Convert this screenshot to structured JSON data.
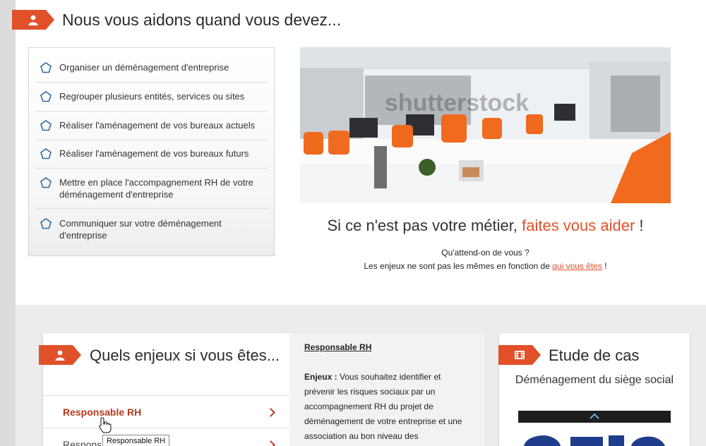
{
  "help_section": {
    "title": "Nous vous aidons quand vous devez...",
    "items": [
      {
        "text": "Organiser un déménagement d'entreprise"
      },
      {
        "text": "Regrouper plusieurs entités, services ou sites"
      },
      {
        "text": "Réaliser l'aménagement de vos bureaux actuels"
      },
      {
        "text": "Réaliser l'aménagement de vos bureaux futurs"
      },
      {
        "text": "Mettre en place l'accompagnement RH de votre déménagement d'entreprise"
      },
      {
        "text": "Communiquer sur votre déménagement d'entreprise"
      }
    ],
    "photo_watermark": "shutterstock",
    "tagline_main": "Si ce n'est pas votre métier, ",
    "tagline_accent": "faites vous aider",
    "tagline_end": " !",
    "question": "Qu'attend-on de vous ?",
    "enjeux_text": "Les enjeux ne sont pas les mêmes en fonction de ",
    "enjeux_link": "qui vous êtes",
    "enjeux_end": " !"
  },
  "enjeux_section": {
    "title": "Quels enjeux si vous êtes...",
    "items": [
      {
        "label": "Responsable RH",
        "active": true
      },
      {
        "label": "Respons",
        "active": false
      }
    ],
    "detail_title": "Responsable RH",
    "detail_label": "Enjeux :",
    "detail_body": " Vous souhaitez identifier et prévenir les risques sociaux par un accompagnement RH du projet de déménagement de votre entreprise et une association au bon niveau des"
  },
  "case_study": {
    "title": "Etude de cas",
    "subtitle": "Déménagement du siège social"
  },
  "tooltip": "Responsable RH",
  "colors": {
    "accent": "#e0512a",
    "chevron": "#c0392b",
    "pentagon": "#2e6da4",
    "active_item": "#b53a1b"
  }
}
